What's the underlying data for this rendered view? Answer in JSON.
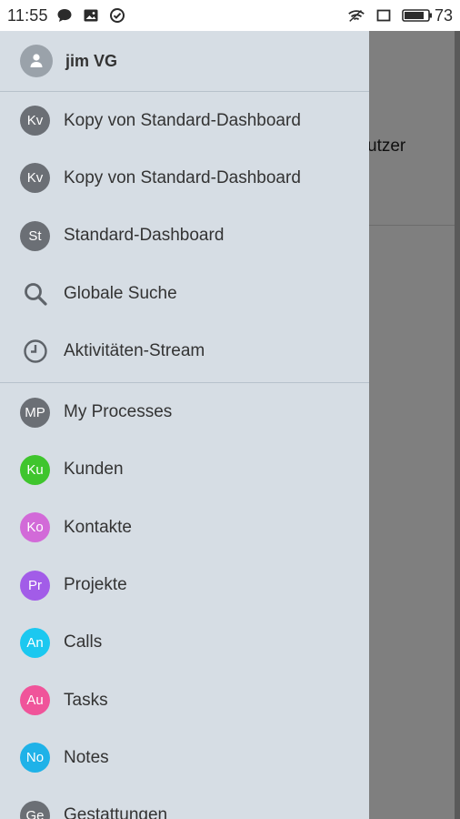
{
  "status_bar": {
    "time": "11:55",
    "battery": "73"
  },
  "background": {
    "row_text": "utzer"
  },
  "drawer": {
    "user": {
      "name": "jim VG"
    },
    "dashboards": [
      {
        "badge": "Kv",
        "label": "Kopy von Standard-Dashboard",
        "color": "#6b6f75"
      },
      {
        "badge": "Kv",
        "label": "Kopy von Standard-Dashboard",
        "color": "#6b6f75"
      },
      {
        "badge": "St",
        "label": "Standard-Dashboard",
        "color": "#6b6f75"
      }
    ],
    "tools": [
      {
        "icon": "search-icon",
        "label": "Globale Suche"
      },
      {
        "icon": "clock-icon",
        "label": "Aktivitäten-Stream"
      }
    ],
    "modules": [
      {
        "badge": "MP",
        "label": "My Processes",
        "color": "#6b6f75"
      },
      {
        "badge": "Ku",
        "label": "Kunden",
        "color": "#3fc52d"
      },
      {
        "badge": "Ko",
        "label": "Kontakte",
        "color": "#d26ad8"
      },
      {
        "badge": "Pr",
        "label": "Projekte",
        "color": "#a25ce8"
      },
      {
        "badge": "An",
        "label": "Calls",
        "color": "#1bc8f0"
      },
      {
        "badge": "Au",
        "label": "Tasks",
        "color": "#f0549a"
      },
      {
        "badge": "No",
        "label": "Notes",
        "color": "#1fb2e8"
      },
      {
        "badge": "Ge",
        "label": "Gestattungen",
        "color": "#6b6f75"
      }
    ]
  }
}
